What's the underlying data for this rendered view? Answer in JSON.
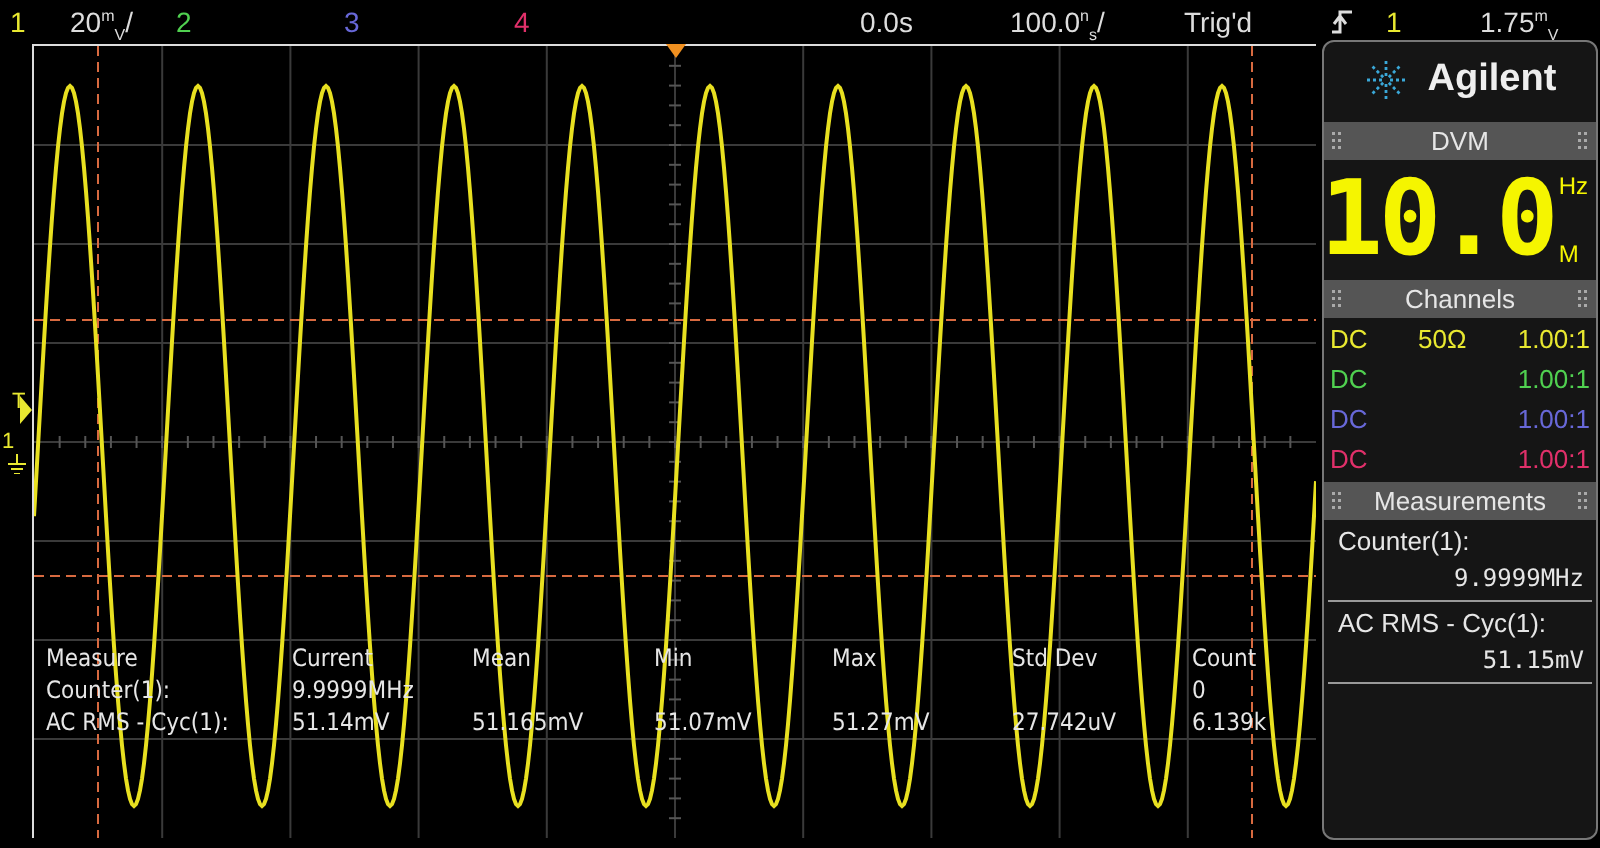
{
  "top_bar": [
    {
      "kind": "channel",
      "label": "1",
      "color": "#e8e830"
    },
    {
      "kind": "text",
      "label": "20$^{m}$$_{V}$/"
    },
    {
      "kind": "channel",
      "label": "2",
      "color": "#50d050"
    },
    {
      "kind": "channel",
      "label": "3",
      "color": "#6868d8"
    },
    {
      "kind": "channel",
      "label": "4",
      "color": "#e0306a"
    },
    {
      "kind": "text",
      "label": "0.0s"
    },
    {
      "kind": "text",
      "label": "100.0$^{n}$$_{s}$/"
    },
    {
      "kind": "text",
      "label": "Trig'd"
    },
    {
      "kind": "slope"
    },
    {
      "kind": "channel",
      "label": "1",
      "color": "#e8e830"
    },
    {
      "kind": "text",
      "label": "1.75$^{m}$$_{V}$"
    }
  ],
  "trigger_marker": {
    "label": "T"
  },
  "channel_marker": {
    "label": "1"
  },
  "measure_table": {
    "columns": [
      "Measure",
      "Current",
      "Mean",
      "Min",
      "Max",
      "Std Dev",
      "Count"
    ],
    "rows": [
      {
        "measure": "Counter(1):",
        "current": "9.9999MHz",
        "count": "0"
      },
      {
        "measure": "AC RMS - Cyc(1):",
        "current": "51.14mV",
        "mean": "51.165mV",
        "min": "51.07mV",
        "max": "51.27mV",
        "std_dev": "27.742uV",
        "count": "6.139k"
      }
    ]
  },
  "panel": {
    "logo": "Agilent",
    "dvm": {
      "title": "DVM",
      "reading": "10.0",
      "unit": "Hz",
      "prefix": "M"
    },
    "channels": {
      "title": "Channels",
      "rows": [
        {
          "coupling": "DC",
          "impedance": "50Ω",
          "probe": "1.00:1",
          "color": "#e8e830"
        },
        {
          "coupling": "DC",
          "probe": "1.00:1",
          "color": "#50d050"
        },
        {
          "coupling": "DC",
          "probe": "1.00:1",
          "color": "#6868d8"
        },
        {
          "coupling": "DC",
          "probe": "1.00:1",
          "color": "#e0306a"
        }
      ]
    },
    "measurements": {
      "title": "Measurements",
      "items": [
        {
          "name": "Counter(",
          "channel": "1",
          "end": "):",
          "value": "9.9999MHz"
        },
        {
          "name": "AC RMS - Cyc(",
          "channel": "1",
          "end": "):",
          "value": "51.15mV"
        }
      ]
    }
  }
}
